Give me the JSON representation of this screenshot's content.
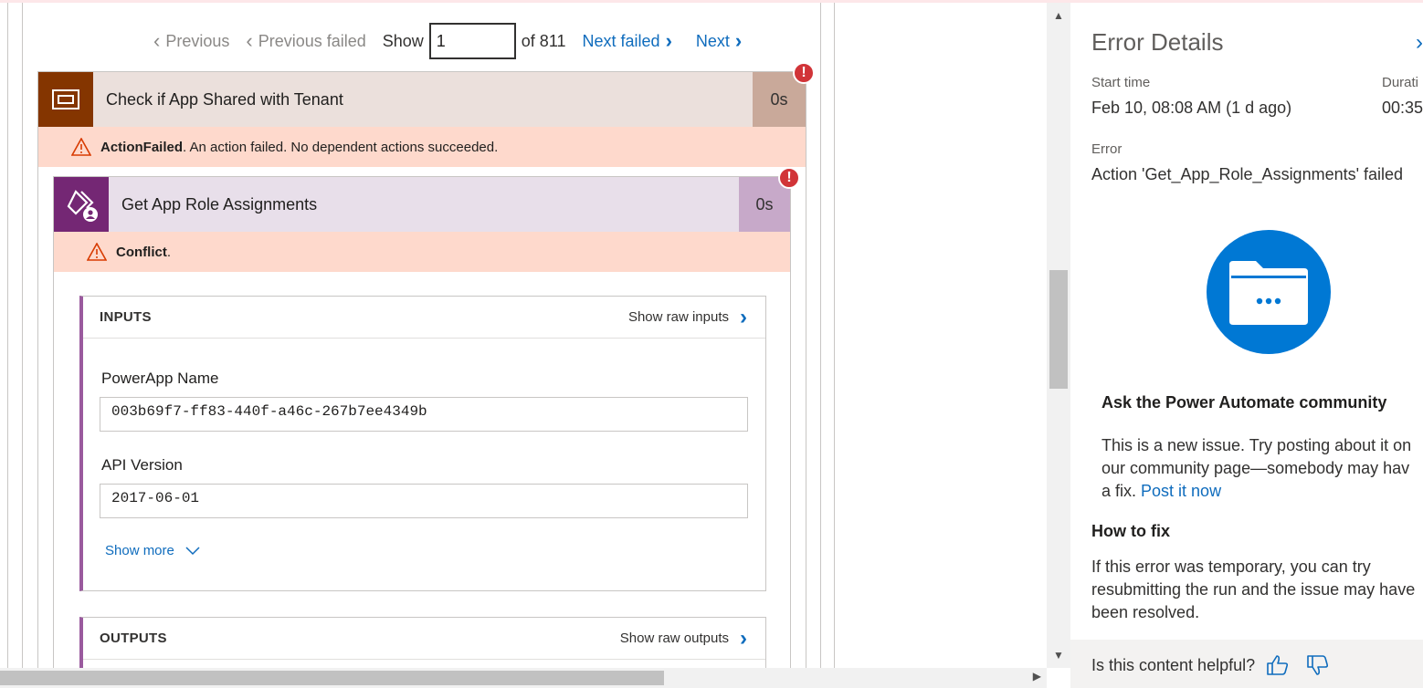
{
  "nav": {
    "previous": "Previous",
    "previous_failed": "Previous failed",
    "show": "Show",
    "page_value": "1",
    "of_total": "of 811",
    "next_failed": "Next failed",
    "next": "Next"
  },
  "outer_action": {
    "title": "Check if App Shared with Tenant",
    "duration": "0s",
    "error_code": "ActionFailed",
    "error_message": ". An action failed. No dependent actions succeeded.",
    "icon": "scope-icon",
    "color": "#843500"
  },
  "inner_action": {
    "title": "Get App Role Assignments",
    "duration": "0s",
    "error_code": "Conflict",
    "error_suffix": ".",
    "icon": "powerapps-admin-icon",
    "color": "#742774"
  },
  "inputs": {
    "title": "INPUTS",
    "raw_label": "Show raw inputs",
    "fields": [
      {
        "label": "PowerApp Name",
        "value": "003b69f7-ff83-440f-a46c-267b7ee4349b"
      },
      {
        "label": "API Version",
        "value": "2017-06-01"
      }
    ],
    "show_more": "Show more"
  },
  "outputs": {
    "title": "OUTPUTS",
    "raw_label": "Show raw outputs"
  },
  "panel": {
    "title": "Error Details",
    "start_time_label": "Start time",
    "start_time_value": "Feb 10, 08:08 AM (1 d ago)",
    "duration_label": "Durati",
    "duration_value": "00:35",
    "error_label": "Error",
    "error_value": "Action 'Get_App_Role_Assignments' failed",
    "community_heading": "Ask the Power Automate community",
    "community_line1": "This is a new issue. Try posting about it on",
    "community_line2": "our community page—somebody may hav",
    "community_line3": "a fix.",
    "post_link": "Post it now",
    "fix_heading": "How to fix",
    "fix_line1": "If this error was temporary, you can try",
    "fix_line2": "resubmitting the run and the issue may have",
    "fix_line3": "been resolved.",
    "helpful": "Is this content helpful?"
  }
}
